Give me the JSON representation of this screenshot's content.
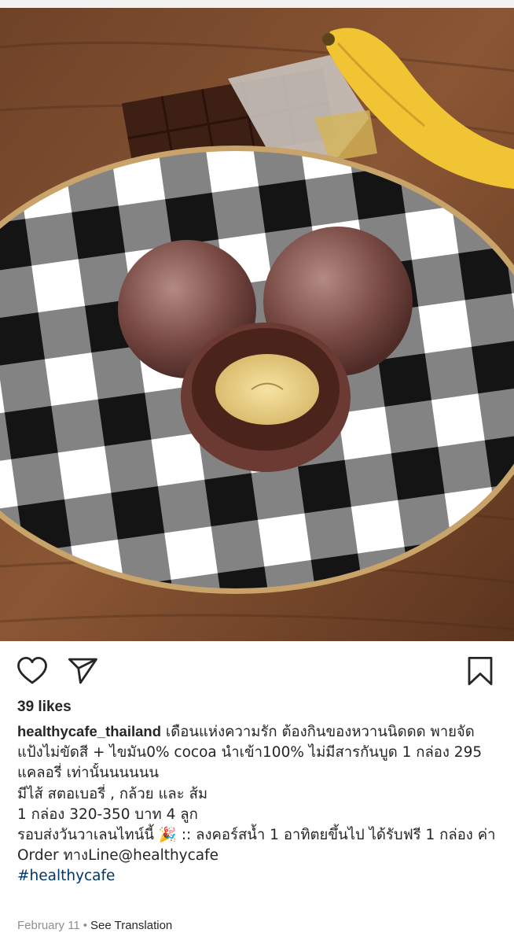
{
  "post": {
    "likes_text": "39 likes",
    "username": "healthycafe_thailand",
    "caption_first": "เดือนแห่งความรัก ต้องกินของหวานนิดดด พายจัด",
    "caption_lines": [
      "แป้งไม่ขัดสี + ไขมัน0% cocoa นำเข้า100% ไม่มีสารกันบูด 1 กล่อง 295",
      "แคลอรี่ เท่านั้นนนนนน",
      "มีไส้ สตอเบอรี่ , กล้วย และ ส้ม",
      "1 กล่อง 320-350 บาท 4 ลูก"
    ],
    "promo_line": "รอบส่งวันวาเลนไทน์นี้ 🎉 :: ลงคอร์สน้ำ 1 อาทิตยขึ้นไป ได้รับฟรี 1 กล่อง ค่า",
    "order_line": "Order ทางLine@healthycafe",
    "hashtag": "#healthycafe",
    "date": "February 11",
    "see_translation": "See Translation"
  },
  "icons": {
    "like": "heart-icon",
    "share": "paper-plane-icon",
    "save": "bookmark-icon"
  },
  "colors": {
    "text": "#262626",
    "muted": "#8e8e8e",
    "hashtag": "#00376b"
  }
}
